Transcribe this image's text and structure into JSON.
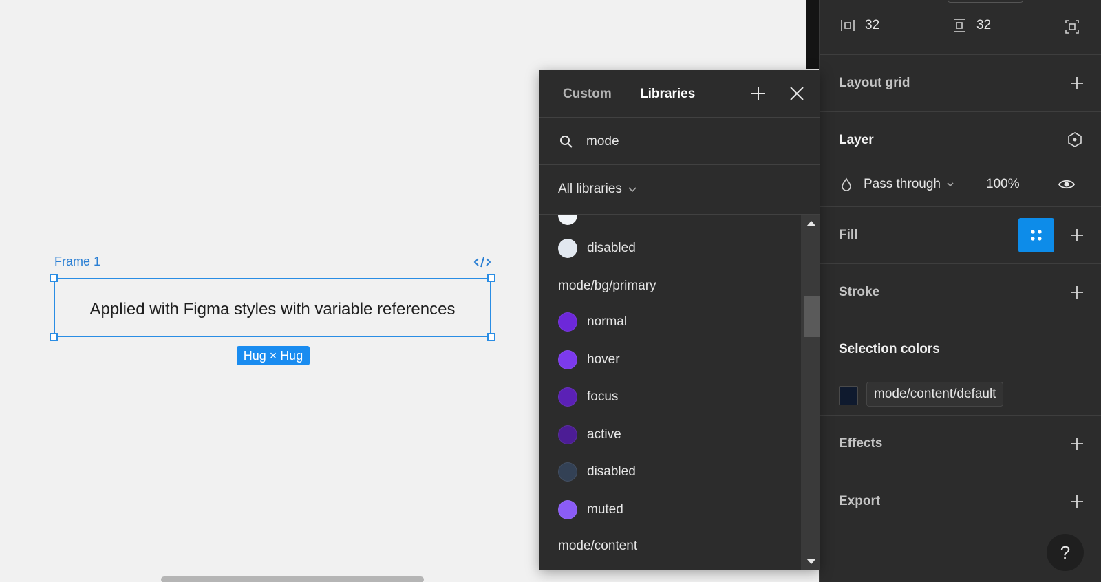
{
  "canvas": {
    "frame_label": "Frame 1",
    "text_content": "Applied with Figma styles with variable references",
    "size_label": "Hug × Hug"
  },
  "popover": {
    "tabs": [
      {
        "label": "Custom",
        "active": false
      },
      {
        "label": "Libraries",
        "active": true
      }
    ],
    "search": {
      "value": "mode"
    },
    "filter_label": "All libraries",
    "list": {
      "items": [
        {
          "type": "color",
          "label": "disabled",
          "color": "#e2e8f0"
        },
        {
          "type": "group",
          "label": "mode/bg/primary"
        },
        {
          "type": "color",
          "label": "normal",
          "color": "#6d28d9"
        },
        {
          "type": "color",
          "label": "hover",
          "color": "#7c3aed"
        },
        {
          "type": "color",
          "label": "focus",
          "color": "#5b21b6"
        },
        {
          "type": "color",
          "label": "active",
          "color": "#4c1d95"
        },
        {
          "type": "color",
          "label": "disabled",
          "color": "#334155"
        },
        {
          "type": "color",
          "label": "muted",
          "color": "#8b5cf6"
        },
        {
          "type": "group",
          "label": "mode/content"
        }
      ]
    }
  },
  "panel": {
    "padding": {
      "horizontal": "32",
      "vertical": "32"
    },
    "layout_grid": {
      "title": "Layout grid"
    },
    "layer": {
      "title": "Layer",
      "blend_mode": "Pass through",
      "opacity": "100%"
    },
    "fill": {
      "title": "Fill"
    },
    "stroke": {
      "title": "Stroke"
    },
    "selection_colors": {
      "title": "Selection colors",
      "style_name": "mode/content/default",
      "swatch_color": "#0f1a2e"
    },
    "effects": {
      "title": "Effects"
    },
    "export": {
      "title": "Export"
    },
    "help_label": "?"
  },
  "colors": {
    "accent": "#0d8ce9",
    "selection": "#2a8de4",
    "panel_bg": "#2c2c2c"
  }
}
